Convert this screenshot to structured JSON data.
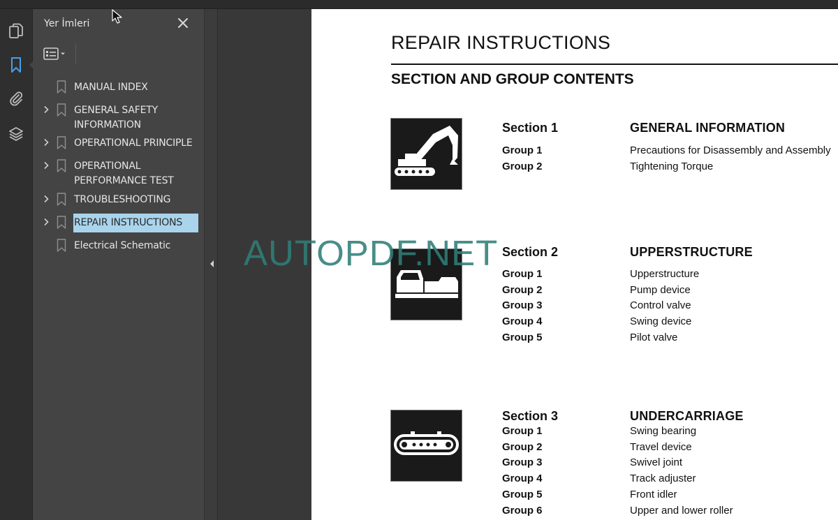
{
  "bookmarks_panel": {
    "title": "Yer İmleri",
    "items": [
      {
        "label": "MANUAL INDEX",
        "expandable": false
      },
      {
        "label": "GENERAL SAFETY\nINFORMATION",
        "expandable": true
      },
      {
        "label": "OPERATIONAL PRINCIPLE",
        "expandable": true
      },
      {
        "label": "OPERATIONAL\nPERFORMANCE TEST",
        "expandable": true
      },
      {
        "label": "TROUBLESHOOTING",
        "expandable": true
      },
      {
        "label": "REPAIR INSTRUCTIONS",
        "expandable": true,
        "selected": true
      },
      {
        "label": "Electrical Schematic",
        "expandable": false
      }
    ]
  },
  "rail_icons": [
    "pages-icon",
    "bookmark-icon",
    "attachment-icon",
    "layers-icon"
  ],
  "document": {
    "title": "REPAIR INSTRUCTIONS",
    "subtitle": "SECTION AND GROUP CONTENTS",
    "sections": [
      {
        "heading": "Section 1",
        "title": "GENERAL INFORMATION",
        "icon": "excavator-icon",
        "groups": [
          {
            "group": "Group 1",
            "desc": "Precautions for Disassembly and Assembly"
          },
          {
            "group": "Group 2",
            "desc": "Tightening Torque"
          }
        ]
      },
      {
        "heading": "Section 2",
        "title": "UPPERSTRUCTURE",
        "icon": "upperstructure-icon",
        "groups": [
          {
            "group": "Group 1",
            "desc": "Upperstructure"
          },
          {
            "group": "Group 2",
            "desc": "Pump device"
          },
          {
            "group": "Group 3",
            "desc": "Control valve"
          },
          {
            "group": "Group 4",
            "desc": "Swing device"
          },
          {
            "group": "Group 5",
            "desc": "Pilot valve"
          }
        ]
      },
      {
        "heading": "Section 3",
        "title": "UNDERCARRIAGE",
        "icon": "track-icon",
        "groups": [
          {
            "group": "Group 1",
            "desc": "Swing bearing"
          },
          {
            "group": "Group 2",
            "desc": "Travel device"
          },
          {
            "group": "Group 3",
            "desc": "Swivel joint"
          },
          {
            "group": "Group 4",
            "desc": "Track adjuster"
          },
          {
            "group": "Group 5",
            "desc": "Front idler"
          },
          {
            "group": "Group 6",
            "desc": "Upper and lower roller"
          }
        ]
      }
    ]
  },
  "watermark": "AUTOPDF.NET",
  "colors": {
    "selection": "#a9d4ec",
    "watermark": "#2f7e78",
    "active_icon": "#4a9ee8"
  }
}
